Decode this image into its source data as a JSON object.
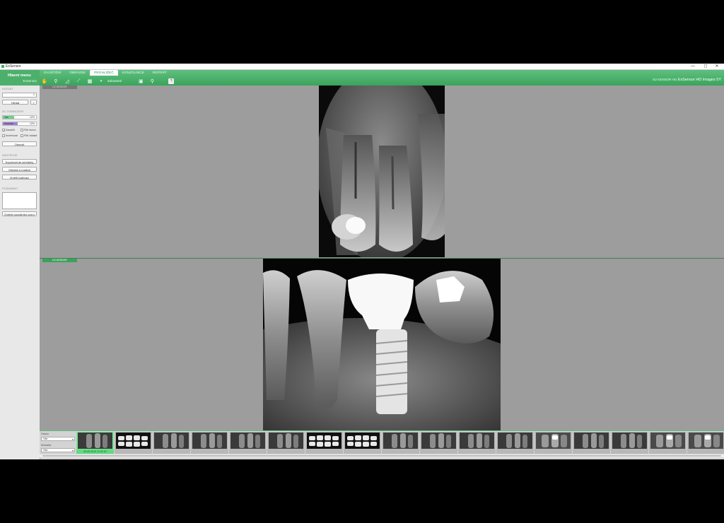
{
  "window": {
    "title": "ExSensor",
    "controls": {
      "minimize": "—",
      "maximize": "◻",
      "close": "✕"
    }
  },
  "ribbon": {
    "menu_title": "Hlavní menu",
    "menu_subtitle": "ExSensor",
    "tabs": [
      "ZAJIŠTĚNÍ",
      "OBRÁZEK",
      "PROHLÍŽEČ",
      "KONZOLNICE",
      "REPORT"
    ],
    "active_tab_index": 2,
    "toolbar_label": "Zobrazení",
    "sensor_title": "EZ-SENSOR HD",
    "sensor_subtitle": "ExSensor HD Images 5Y"
  },
  "sidebar": {
    "search_label": "HLEDAT",
    "search_count": "0",
    "search_button": "Hledat",
    "search_plus": "+",
    "view_label": "2D ZOBRAZENÍ",
    "sliders": [
      {
        "label": "Jas",
        "value": "12%",
        "color": "#6fd08f",
        "fraction": 0.35
      },
      {
        "label": "Kontrast",
        "value": "12%",
        "color": "#9e82d9",
        "fraction": 0.45
      }
    ],
    "checks": [
      {
        "label": "Zaostřit",
        "checked": true
      },
      {
        "label": "Filtr šumu",
        "checked": false
      },
      {
        "label": "Invertovat",
        "checked": false
      },
      {
        "label": "Filtr oblasti",
        "checked": false
      }
    ],
    "reset_button": "Obnovit",
    "tools_label": "NÁSTROJE",
    "tool_buttons": [
      "Kopírovat do schránky",
      "Odeslat e-mailem",
      "Změřit kalibraci"
    ],
    "notes_label": "POZNÁMKY",
    "notes_button": "Změnit poznámku vzoru"
  },
  "viewer": {
    "top_label": "EZ-SENSOR",
    "bottom_label": "EZ-SENSOR"
  },
  "filmstrip": {
    "date_label": "Datum",
    "date_value": "Vše",
    "modality_label": "Modalita",
    "modality_value": "Vše",
    "selected_date": "25.05.2019 11:51:52",
    "thumbnails": [
      {
        "type": "pa",
        "selected": true
      },
      {
        "type": "bw"
      },
      {
        "type": "pa"
      },
      {
        "type": "pa"
      },
      {
        "type": "pa"
      },
      {
        "type": "pa"
      },
      {
        "type": "bw"
      },
      {
        "type": "bw"
      },
      {
        "type": "pa"
      },
      {
        "type": "pa"
      },
      {
        "type": "pa"
      },
      {
        "type": "pa"
      },
      {
        "type": "fill"
      },
      {
        "type": "pa"
      },
      {
        "type": "pa"
      },
      {
        "type": "fill"
      },
      {
        "type": "fill"
      },
      {
        "type": "pa"
      }
    ]
  },
  "colors": {
    "accent": "#3aa35b",
    "selected_thumb": "#7ee29a",
    "viewer_background": "#9d9d9d"
  }
}
